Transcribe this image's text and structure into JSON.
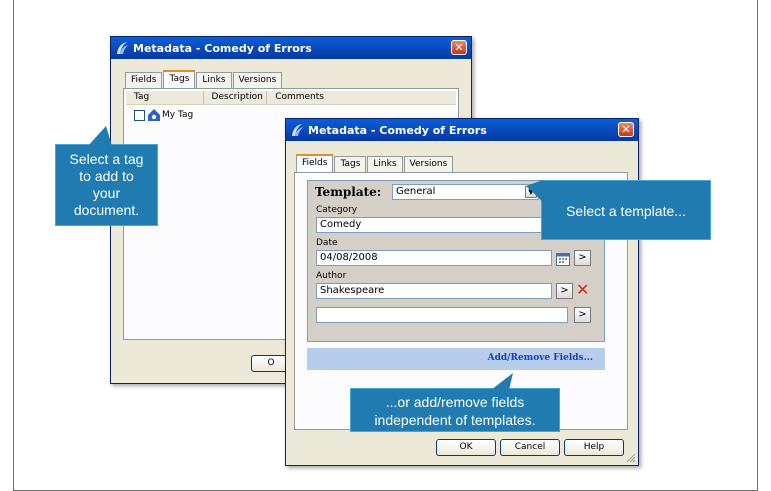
{
  "back_window": {
    "title": "Metadata - Comedy of Errors",
    "tabs": [
      "Fields",
      "Tags",
      "Links",
      "Versions"
    ],
    "columns": [
      "Tag",
      "Description",
      "Comments"
    ],
    "tag_label": "My Tag",
    "ok_partial": "O"
  },
  "front_window": {
    "title": "Metadata - Comedy of Errors",
    "tabs": [
      "Fields",
      "Tags",
      "Links",
      "Versions"
    ],
    "template_label": "Template:",
    "template_value": "General",
    "category_label": "Category",
    "category_value": "Comedy",
    "date_label": "Date",
    "date_value": "04/08/2008",
    "author_label": "Author",
    "author_value": "Shakespeare",
    "author_extra_value": "",
    "arrow_label": ">",
    "add_remove_link": "Add/Remove Fields...",
    "ok_label": "OK",
    "cancel_label": "Cancel",
    "help_label": "Help"
  },
  "callouts": {
    "tag": [
      "Select a tag",
      "to add to",
      "your",
      "document."
    ],
    "template": "Select a template...",
    "fields": [
      "...or add/remove fields",
      "independent of templates."
    ]
  },
  "colors": {
    "titlebar": "#0847b8",
    "callout": "#1f7bb0",
    "link": "#1a3fb3",
    "delete_x": "#d9261c"
  }
}
